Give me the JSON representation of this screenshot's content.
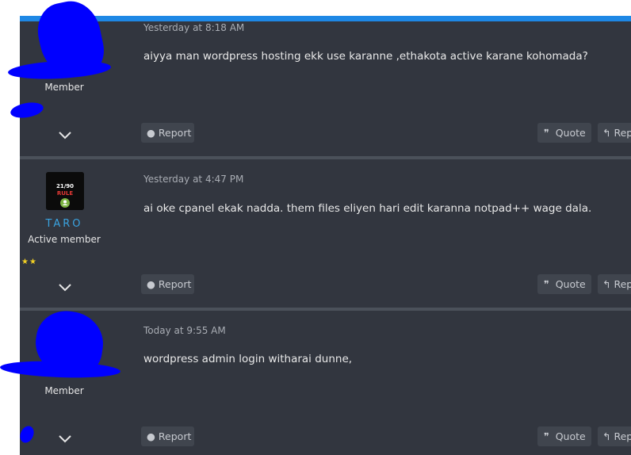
{
  "posts": [
    {
      "date": "Yesterday at 8:18 AM",
      "body": "aiyya man wordpress hosting ekk use karanne ,ethakota active karane kohomada?",
      "user_title": "Member",
      "actions": {
        "report": "Report",
        "quote": "Quote",
        "reply": "Rep"
      }
    },
    {
      "date": "Yesterday at 4:47 PM",
      "body": "ai oke cpanel ekak nadda. them files eliyen hari edit karanna notpad++ wage dala.",
      "username": "TARO",
      "user_title": "Active member",
      "avatar_text": "21/90 RULE",
      "stars": "★★",
      "actions": {
        "report": "Report",
        "quote": "Quote",
        "reply": "Rep"
      }
    },
    {
      "date": "Today at 9:55 AM",
      "body": "wordpress admin login witharai dunne,",
      "user_title": "Member",
      "actions": {
        "report": "Report",
        "quote": "Quote",
        "reply": "Rep"
      }
    }
  ],
  "colors": {
    "accent": "#1e88e5",
    "username": "#3aa3e0",
    "redaction": "#0000ff",
    "star": "#f2d024"
  },
  "icons": [
    "report-icon",
    "quote-icon",
    "reply-icon",
    "chevron-down-icon"
  ]
}
